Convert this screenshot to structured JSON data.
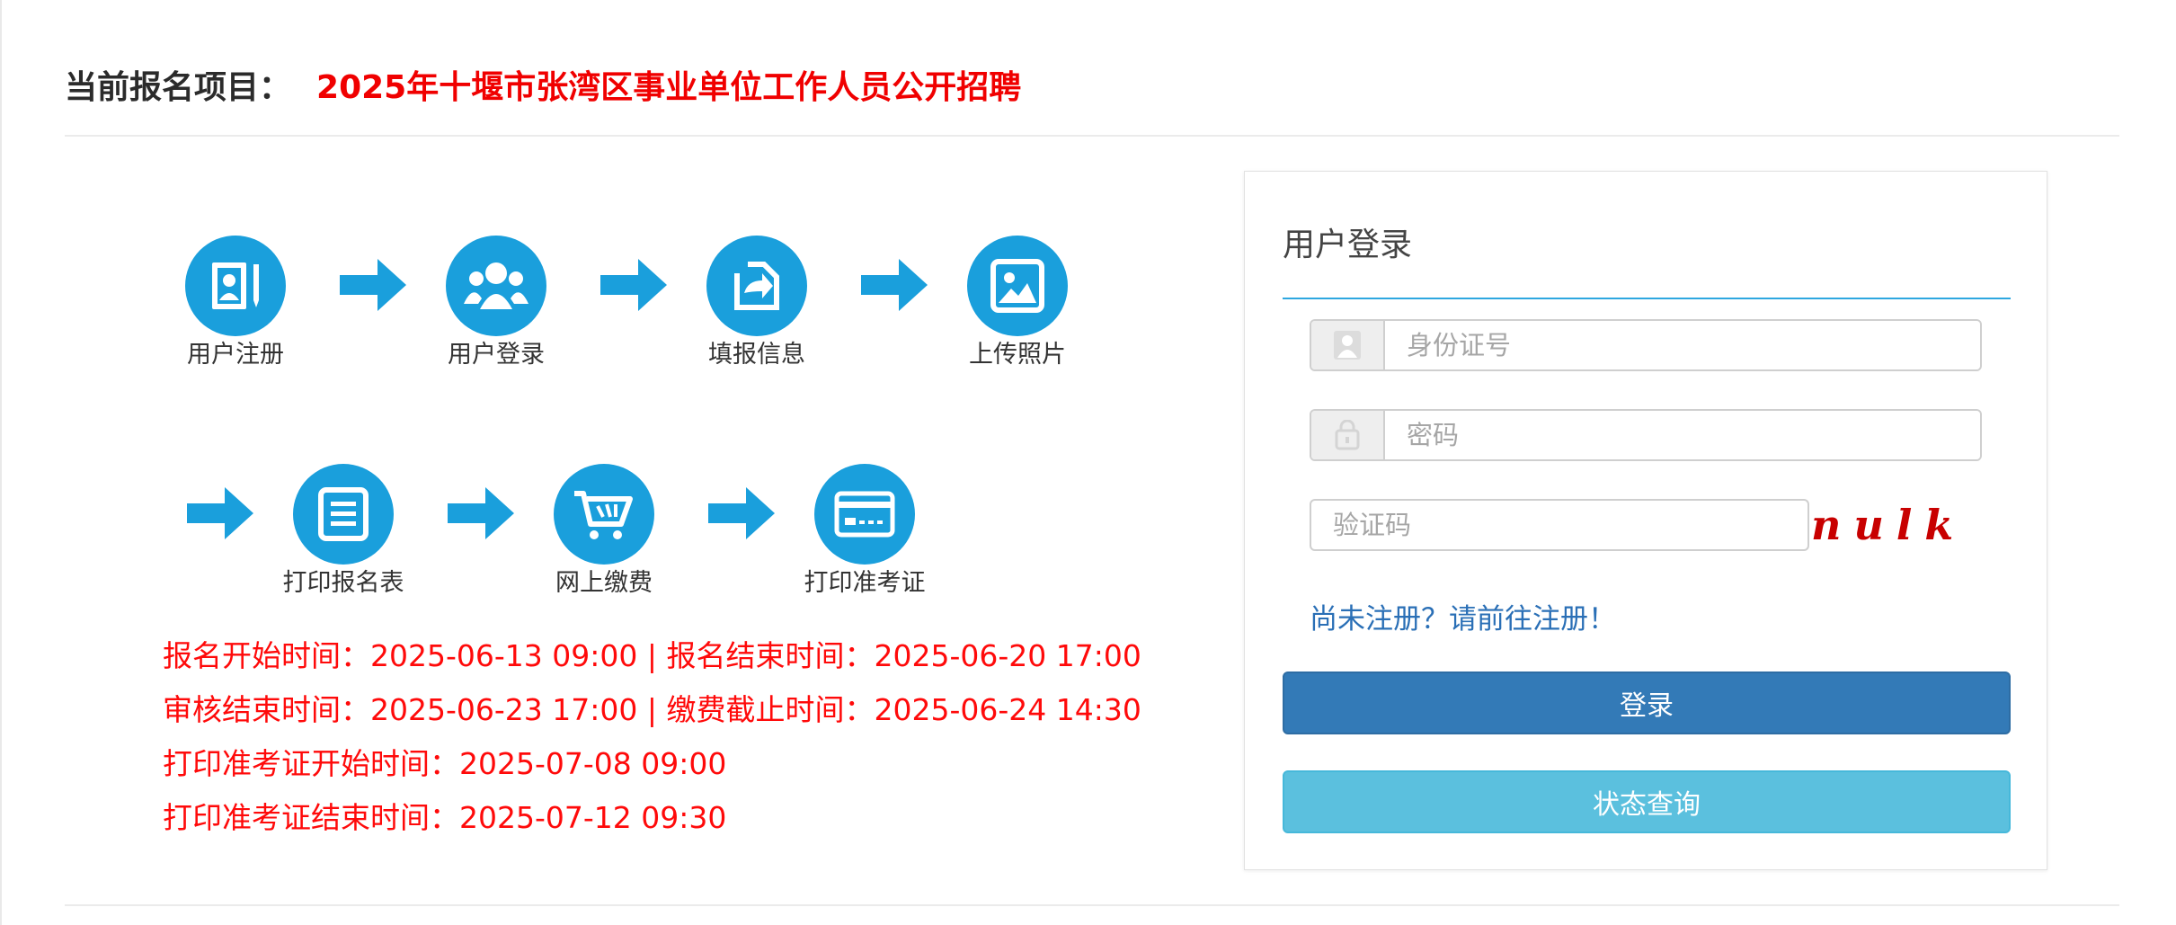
{
  "header": {
    "label": "当前报名项目：",
    "project": "2025年十堰市张湾区事业单位工作人员公开招聘"
  },
  "colors": {
    "accent_blue": "#1a9fdc",
    "warning_red": "#ff0a0a",
    "primary_button": "#337ab7",
    "info_button": "#5bc0de",
    "panel_rule": "#2ea7e0"
  },
  "steps": [
    {
      "label": "用户注册",
      "icon": "user-register-icon"
    },
    {
      "label": "用户登录",
      "icon": "user-group-icon"
    },
    {
      "label": "填报信息",
      "icon": "fill-info-icon"
    },
    {
      "label": "上传照片",
      "icon": "photo-icon"
    },
    {
      "label": "打印报名表",
      "icon": "form-list-icon"
    },
    {
      "label": "网上缴费",
      "icon": "shopping-cart-icon"
    },
    {
      "label": "打印准考证",
      "icon": "ticket-card-icon"
    }
  ],
  "dates": [
    "报名开始时间：2025-06-13 09:00 | 报名结束时间：2025-06-20 17:00",
    "审核结束时间：2025-06-23 17:00 | 缴费截止时间：2025-06-24 14:30",
    "打印准考证开始时间：2025-07-08 09:00",
    "打印准考证结束时间：2025-07-12 09:30"
  ],
  "login": {
    "title": "用户登录",
    "id_placeholder": "身份证号",
    "password_placeholder": "密码",
    "captcha_placeholder": "验证码",
    "captcha_text": "nulk",
    "register_link": "尚未注册？请前往注册！",
    "login_button": "登录",
    "status_button": "状态查询"
  }
}
